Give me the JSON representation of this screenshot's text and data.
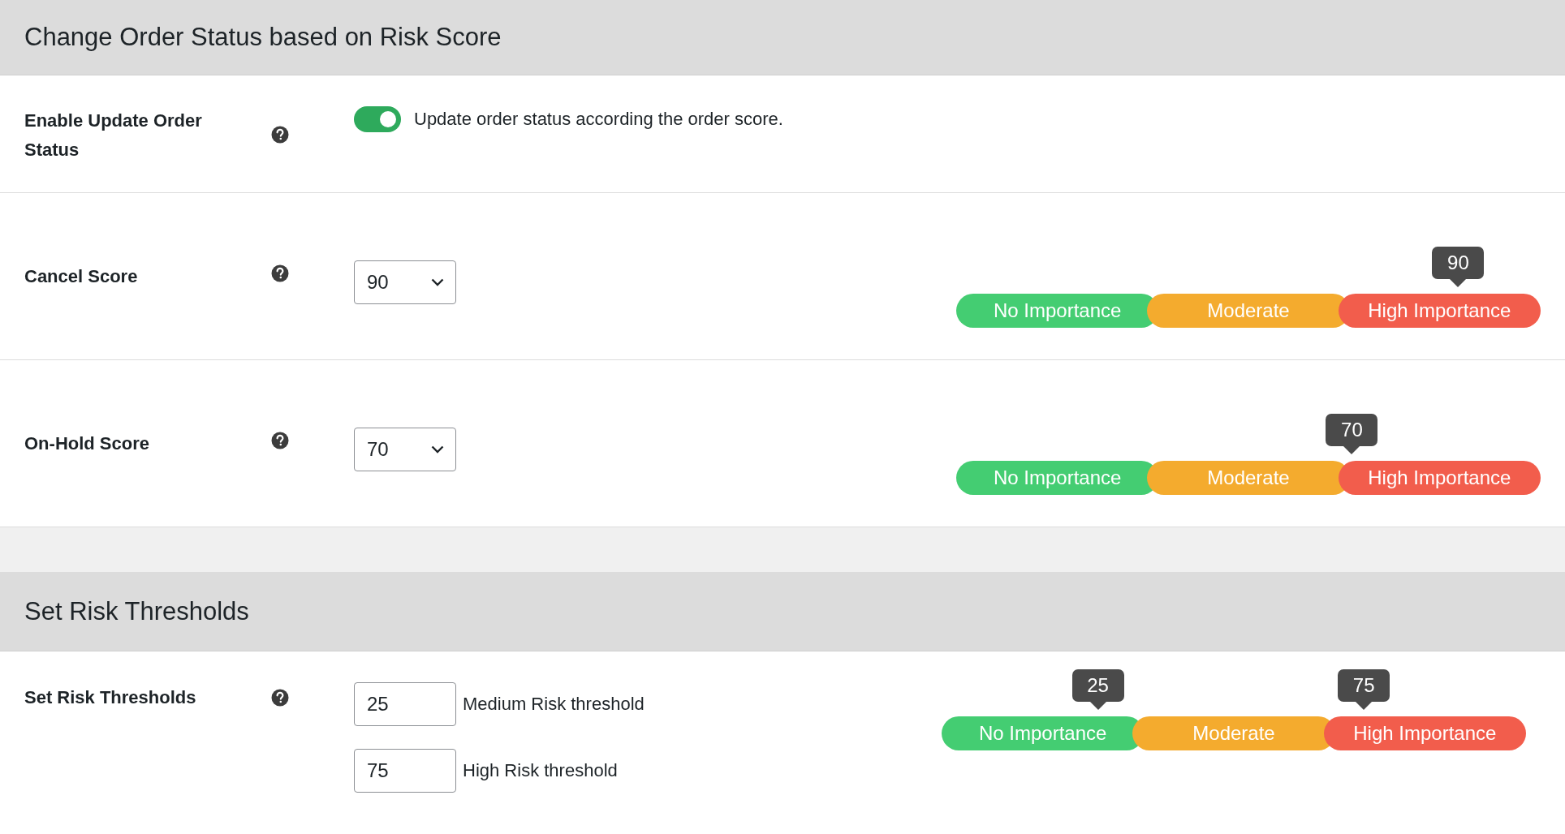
{
  "sections": [
    {
      "title": "Change Order Status based on Risk Score",
      "rows": [
        {
          "kind": "toggle",
          "label": "Enable Update Order Status",
          "on": true,
          "description": "Update order status according the order score."
        },
        {
          "kind": "select",
          "label": "Cancel Score",
          "value": "90",
          "scale": {
            "segments": [
              {
                "label": "No Importance",
                "color": "#44cd72"
              },
              {
                "label": "Moderate",
                "color": "#f4ab2e"
              },
              {
                "label": "High Importance",
                "color": "#f25d4c"
              }
            ],
            "markers": [
              {
                "text": "90"
              }
            ]
          }
        },
        {
          "kind": "select",
          "label": "On-Hold Score",
          "value": "70",
          "scale": {
            "segments": [
              {
                "label": "No Importance",
                "color": "#44cd72"
              },
              {
                "label": "Moderate",
                "color": "#f4ab2e"
              },
              {
                "label": "High Importance",
                "color": "#f25d4c"
              }
            ],
            "markers": [
              {
                "text": "70"
              }
            ]
          }
        }
      ]
    },
    {
      "title": "Set Risk Thresholds",
      "rows": [
        {
          "kind": "thresholds",
          "label": "Set Risk Thresholds",
          "fields": [
            {
              "value": "25",
              "label": "Medium Risk threshold"
            },
            {
              "value": "75",
              "label": "High Risk threshold"
            }
          ],
          "scale": {
            "segments": [
              {
                "label": "No Importance",
                "color": "#44cd72"
              },
              {
                "label": "Moderate",
                "color": "#f4ab2e"
              },
              {
                "label": "High Importance",
                "color": "#f25d4c"
              }
            ],
            "markers": [
              {
                "text": "25"
              },
              {
                "text": "75"
              }
            ]
          }
        }
      ]
    }
  ]
}
